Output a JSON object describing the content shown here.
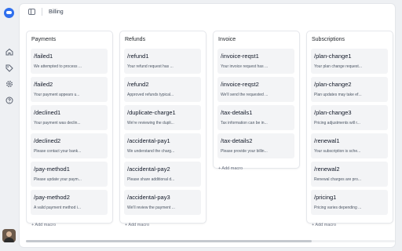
{
  "header": {
    "title": "Billing"
  },
  "rail": {
    "icons": [
      "logo-icon",
      "home-icon",
      "tag-icon",
      "settings-icon",
      "help-icon"
    ]
  },
  "columns": [
    {
      "title": "Payments",
      "cards": [
        {
          "title": "/failed1",
          "desc": "We attempted to process ..."
        },
        {
          "title": "/failed2",
          "desc": "Your payment appears u..."
        },
        {
          "title": "/declined1",
          "desc": "Your payment was declin..."
        },
        {
          "title": "/declined2",
          "desc": "Please contact your bank..."
        },
        {
          "title": "/pay-method1",
          "desc": "Please update your paym..."
        },
        {
          "title": "/pay-method2",
          "desc": "A valid payment method i..."
        }
      ],
      "add_label": "+ Add macro"
    },
    {
      "title": "Refunds",
      "cards": [
        {
          "title": "/refund1",
          "desc": "Your refund request has ..."
        },
        {
          "title": "/refund2",
          "desc": "Approved refunds typical..."
        },
        {
          "title": "/duplicate-charge1",
          "desc": "We're reviewing the dupli..."
        },
        {
          "title": "/accidental-pay1",
          "desc": "We understand the charg..."
        },
        {
          "title": "/accidental-pay2",
          "desc": "Please share additional d..."
        },
        {
          "title": "/accidental-pay3",
          "desc": "We'll review the payment ..."
        }
      ],
      "add_label": "+ Add macro"
    },
    {
      "title": "Invoice",
      "cards": [
        {
          "title": "/invoice-reqst1",
          "desc": "Your invoice request has ..."
        },
        {
          "title": "/invoice-reqst2",
          "desc": "We'll send the requested ..."
        },
        {
          "title": "/tax-details1",
          "desc": "Tax information can be in..."
        },
        {
          "title": "/tax-details2",
          "desc": "Please provide your billin..."
        }
      ],
      "add_label": "+ Add macro"
    },
    {
      "title": "Subscriptions",
      "cards": [
        {
          "title": "/plan-change1",
          "desc": "Your plan change request..."
        },
        {
          "title": "/plan-change2",
          "desc": "Plan updates may take ef..."
        },
        {
          "title": "/plan-change3",
          "desc": "Pricing adjustments will r..."
        },
        {
          "title": "/renewal1",
          "desc": "Your subscription is sche..."
        },
        {
          "title": "/renewal2",
          "desc": "Renewal charges are pro..."
        },
        {
          "title": "/pricing1",
          "desc": "Pricing varies depending ..."
        }
      ],
      "add_label": "+ Add macro"
    }
  ]
}
